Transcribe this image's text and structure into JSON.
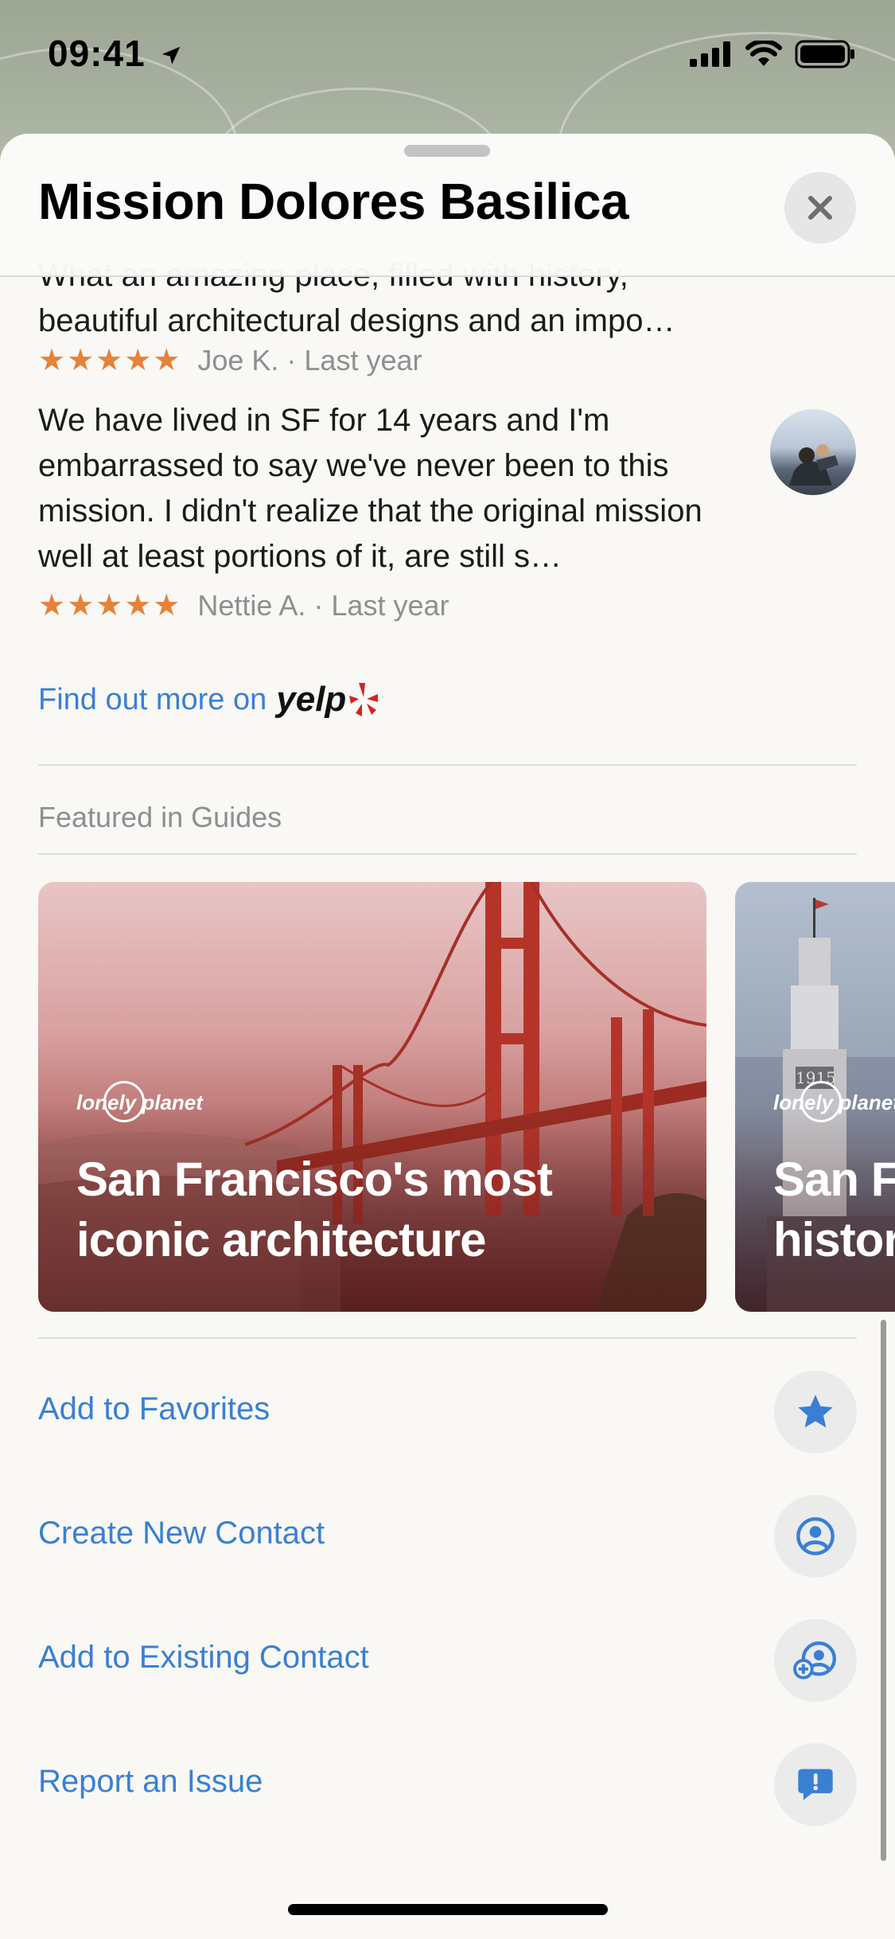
{
  "status_bar": {
    "time": "09:41"
  },
  "sheet": {
    "title": "Mission Dolores Basilica",
    "close_label": "×"
  },
  "reviews": [
    {
      "text_line_1": "What an amazing place, filled with history,",
      "text_line_2": "beautiful architectural designs and an impo…",
      "stars": "★★★★★",
      "meta": "Joe K. · Last year"
    },
    {
      "text": "We have lived in SF for 14 years and I'm embarrassed to say we've never been to this mission. I didn't realize that the original mission well at least portions of it, are still s…",
      "stars": "★★★★★",
      "meta": "Nettie A. · Last year"
    }
  ],
  "yelp": {
    "link_text": "Find out more on",
    "logo_text": "yelp"
  },
  "guides": {
    "section_label": "Featured in Guides",
    "cards": [
      {
        "brand": "lonely planet",
        "title_line_1": "San Francisco's most",
        "title_line_2": "iconic architecture"
      },
      {
        "brand": "lonely planet",
        "title_line_1": "San F",
        "title_line_2": "histor",
        "tower_year": "1915"
      }
    ]
  },
  "actions": [
    {
      "label": "Add to Favorites",
      "icon": "star-icon"
    },
    {
      "label": "Create New Contact",
      "icon": "person-circle-icon"
    },
    {
      "label": "Add to Existing Contact",
      "icon": "person-add-icon"
    },
    {
      "label": "Report an Issue",
      "icon": "exclamation-bubble-icon"
    }
  ],
  "colors": {
    "link_blue": "#3a7fd4",
    "star_orange": "#e6823a",
    "yelp_red": "#d32323"
  }
}
